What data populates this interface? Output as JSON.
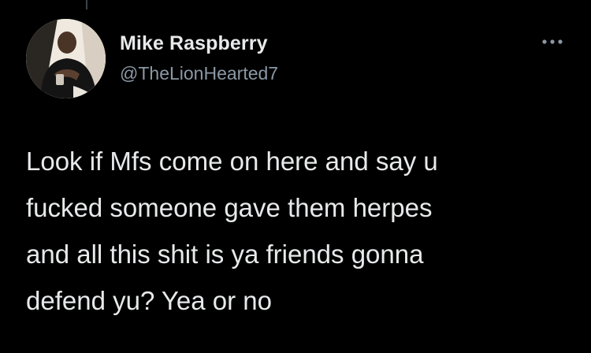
{
  "author": {
    "display_name": "Mike Raspberry",
    "handle": "@TheLionHearted7",
    "avatar_icon": "profile-photo"
  },
  "more_menu_icon": "ellipsis-icon",
  "tweet": {
    "lines": [
      "Look if Mfs come on here and say u",
      "fucked someone gave them herpes",
      "and all this shit is ya friends gonna",
      "defend yu? Yea or no"
    ]
  },
  "colors": {
    "background": "#000000",
    "primary_text": "#e7e9ea",
    "secondary_text": "#8b98a5"
  }
}
